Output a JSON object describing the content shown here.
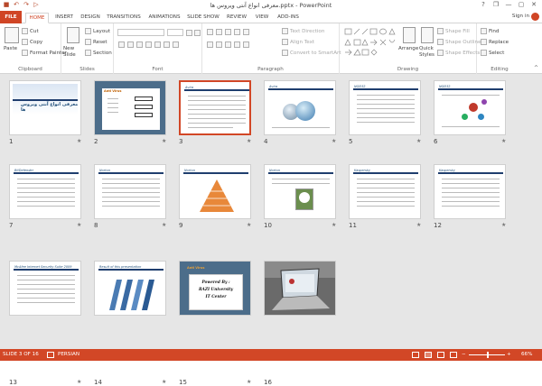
{
  "window": {
    "title": "معرفی انواع آنتی ویروس ها.pptx - PowerPoint",
    "min_glyph": "—",
    "max_glyph": "▢",
    "close_glyph": "✕",
    "help_glyph": "?",
    "restore_glyph": "❐"
  },
  "qat": {
    "save": "■",
    "undo": "↶",
    "redo": "↷",
    "start": "▷"
  },
  "tabs": [
    "FILE",
    "HOME",
    "INSERT",
    "DESIGN",
    "TRANSITIONS",
    "ANIMATIONS",
    "SLIDE SHOW",
    "REVIEW",
    "VIEW",
    "ADD-INS"
  ],
  "signin": "Sign in",
  "ribbon": {
    "clipboard": {
      "label": "Clipboard",
      "paste": "Paste",
      "cut": "Cut",
      "copy": "Copy",
      "format_painter": "Format Painter"
    },
    "slides": {
      "label": "Slides",
      "new_slide": "New Slide",
      "layout": "Layout",
      "reset": "Reset",
      "section": "Section"
    },
    "font": {
      "label": "Font"
    },
    "paragraph": {
      "label": "Paragraph",
      "text_direction": "Text Direction",
      "align_text": "Align Text",
      "convert": "Convert to SmartArt"
    },
    "drawing": {
      "label": "Drawing",
      "arrange": "Arrange",
      "quick_styles": "Quick Styles",
      "shape_fill": "Shape Fill",
      "shape_outline": "Shape Outline",
      "shape_effects": "Shape Effects"
    },
    "editing": {
      "label": "Editing",
      "find": "Find",
      "replace": "Replace",
      "select": "Select"
    }
  },
  "slides": [
    {
      "num": "1",
      "title": "معرفی انواع آنتی ویروس ها"
    },
    {
      "num": "2",
      "title": "Anti Virus"
    },
    {
      "num": "3",
      "title": "Avira"
    },
    {
      "num": "4",
      "title": "Avira"
    },
    {
      "num": "5",
      "title": "NOD32"
    },
    {
      "num": "6",
      "title": "NOD32"
    },
    {
      "num": "7",
      "title": "BitDefender"
    },
    {
      "num": "8",
      "title": "Norton"
    },
    {
      "num": "9",
      "title": "Norton"
    },
    {
      "num": "10",
      "title": "Norton"
    },
    {
      "num": "11",
      "title": "Kaspersky"
    },
    {
      "num": "12",
      "title": "Kaspersky"
    },
    {
      "num": "13",
      "title": "McAfee Internet Security Suite 2009"
    },
    {
      "num": "14",
      "title": "Result of this presentation"
    },
    {
      "num": "15",
      "title": "Anti Virus",
      "body": [
        "Powered By :",
        "RAZI University",
        "IT Center"
      ]
    },
    {
      "num": "16",
      "title": ""
    }
  ],
  "star": "★",
  "status": {
    "slide": "SLIDE 3 OF 16",
    "lang": "PERSIAN",
    "zoom": "66%",
    "minus": "−",
    "plus": "+"
  },
  "colors": {
    "accent": "#d24726",
    "ribbon_bg": "#ffffff",
    "sorter_bg": "#e6e6e6"
  }
}
